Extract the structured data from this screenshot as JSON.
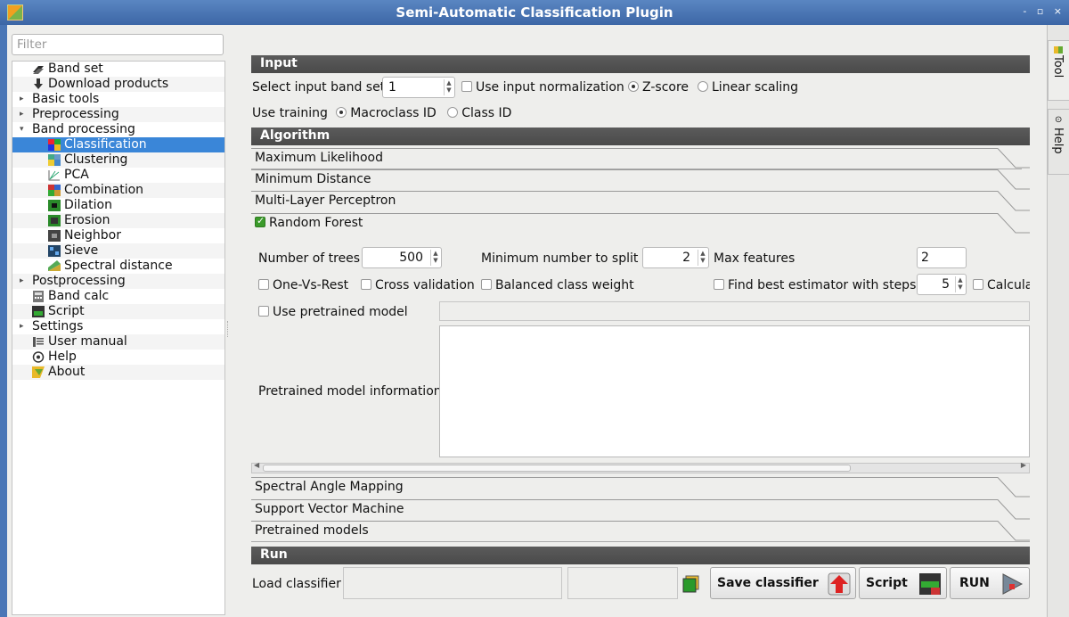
{
  "window": {
    "title": "Semi-Automatic Classification Plugin",
    "controls": "- ▫ ×"
  },
  "sidebar": {
    "filter_placeholder": "Filter",
    "items": [
      {
        "label": "Band set"
      },
      {
        "label": "Download products"
      },
      {
        "label": "Basic tools"
      },
      {
        "label": "Preprocessing"
      },
      {
        "label": "Band processing"
      },
      {
        "label": "Classification"
      },
      {
        "label": "Clustering"
      },
      {
        "label": "PCA"
      },
      {
        "label": "Combination"
      },
      {
        "label": "Dilation"
      },
      {
        "label": "Erosion"
      },
      {
        "label": "Neighbor"
      },
      {
        "label": "Sieve"
      },
      {
        "label": "Spectral distance"
      },
      {
        "label": "Postprocessing"
      },
      {
        "label": "Band calc"
      },
      {
        "label": "Script"
      },
      {
        "label": "Settings"
      },
      {
        "label": "User manual"
      },
      {
        "label": "Help"
      },
      {
        "label": "About"
      }
    ]
  },
  "input": {
    "header": "Input",
    "band_set_label": "Select input band set",
    "band_set_value": "1",
    "normalization_label": "Use input normalization",
    "zscore_label": "Z-score",
    "linear_label": "Linear scaling",
    "training_label": "Use training",
    "macroclass_label": "Macroclass ID",
    "classid_label": "Class ID"
  },
  "algorithm": {
    "header": "Algorithm",
    "tabs": [
      "Maximum Likelihood",
      "Minimum Distance",
      "Multi-Layer Perceptron",
      "Random Forest"
    ],
    "rf": {
      "trees_label": "Number of trees",
      "trees_value": "500",
      "min_split_label": "Minimum number to split",
      "min_split_value": "2",
      "max_features_label": "Max features",
      "max_features_value": "2",
      "ovr_label": "One-Vs-Rest",
      "cv_label": "Cross validation",
      "balanced_label": "Balanced class weight",
      "best_est_label": "Find best estimator with steps",
      "best_est_value": "5",
      "calc_label": "Calcula",
      "pretrained_label": "Use pretrained model",
      "pretrained_info_label": "Pretrained model information"
    },
    "tabs_after": [
      "Spectral Angle Mapping",
      "Support Vector Machine",
      "Pretrained models"
    ]
  },
  "run": {
    "header": "Run",
    "load_label": "Load classifier",
    "save_label": "Save classifier",
    "script_label": "Script",
    "run_label": "RUN"
  },
  "dock": {
    "tool_tab": "Tool",
    "help_tab": "Help"
  }
}
